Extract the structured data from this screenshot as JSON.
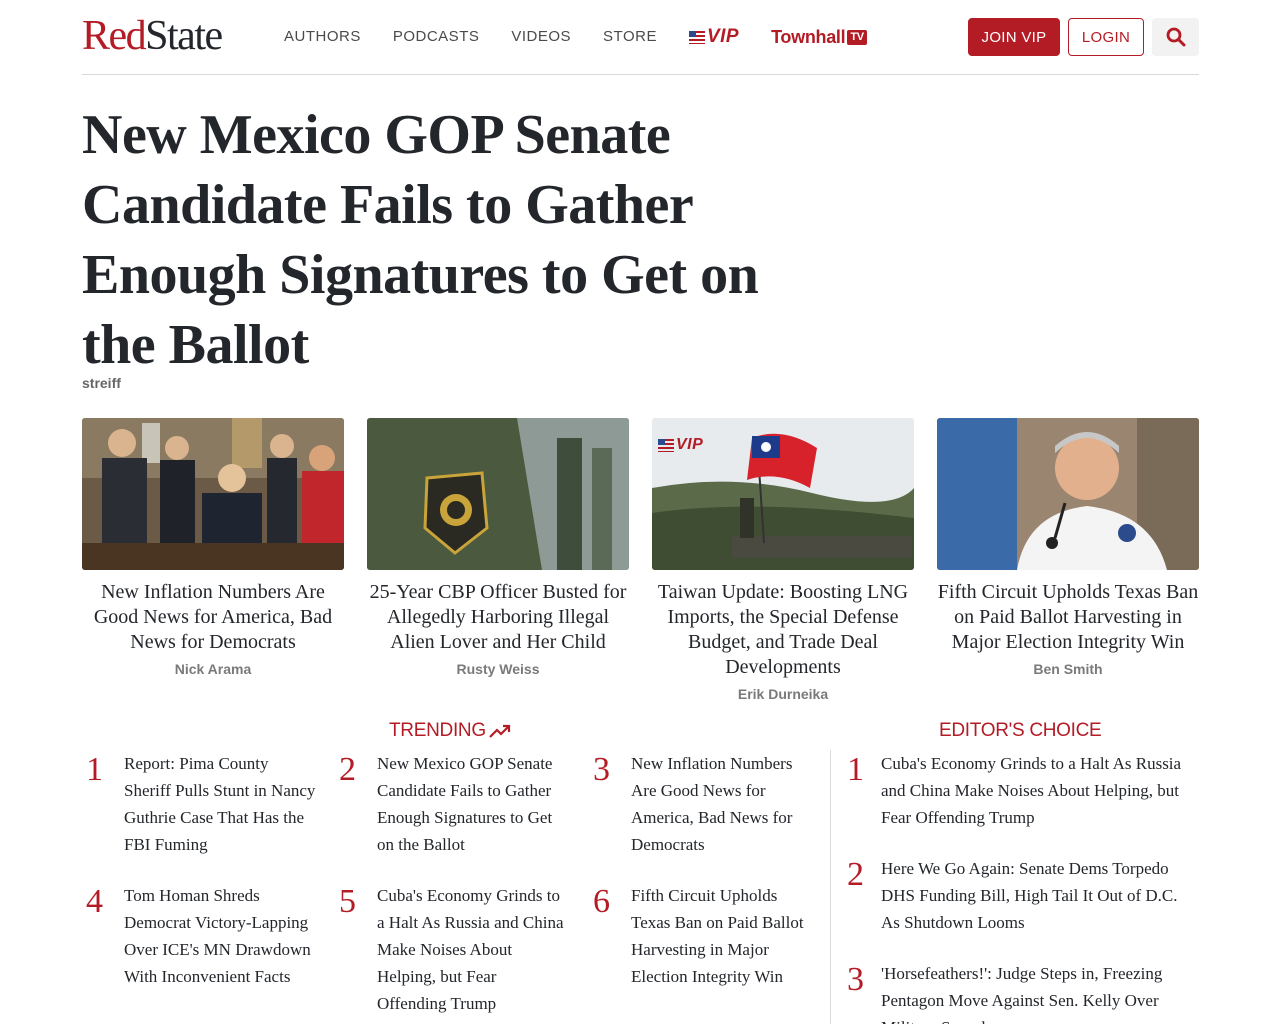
{
  "brand": {
    "logo_part1": "Red",
    "logo_part2": "State",
    "red": "#b41c25",
    "dark": "#23262b"
  },
  "nav": {
    "authors": "AUTHORS",
    "podcasts": "PODCASTS",
    "videos": "VIDEOS",
    "store": "STORE",
    "vip": "VIP",
    "townhall": "Townhall",
    "townhall_tv": "TV"
  },
  "header_buttons": {
    "join_vip": "JOIN VIP",
    "login": "LOGIN",
    "search_icon": "search-icon"
  },
  "article": {
    "headline": "New Mexico GOP Senate Candidate Fails to Gather Enough Signatures to Get on the Ballot",
    "byline": "streiff"
  },
  "cards": [
    {
      "title": "New Inflation Numbers Are Good News for America, Bad News for Democrats",
      "author": "Nick Arama"
    },
    {
      "title": "25-Year CBP Officer Busted for Allegedly Harboring Illegal Alien Lover and Her Child",
      "author": "Rusty Weiss"
    },
    {
      "title": "Taiwan Update: Boosting LNG Imports, the Special Defense Budget, and Trade Deal Developments",
      "author": "Erik Durneika",
      "badge": "VIP"
    },
    {
      "title": "Fifth Circuit Upholds Texas Ban on Paid Ballot Harvesting in Major Election Integrity Win",
      "author": "Ben Smith"
    }
  ],
  "trending": {
    "heading": "TRENDING",
    "items": [
      {
        "num": "1",
        "text": "Report: Pima County Sheriff Pulls Stunt in Nancy Guthrie Case That Has the FBI Fuming"
      },
      {
        "num": "2",
        "text": "New Mexico GOP Senate Candidate Fails to Gather Enough Signatures to Get on the Ballot"
      },
      {
        "num": "3",
        "text": "New Inflation Numbers Are Good News for America, Bad News for Democrats"
      },
      {
        "num": "4",
        "text": "Tom Homan Shreds Democrat Victory-Lapping Over ICE's MN Drawdown With Inconvenient Facts"
      },
      {
        "num": "5",
        "text": "Cuba's Economy Grinds to a Halt As Russia and China Make Noises About Helping, but Fear Offending Trump"
      },
      {
        "num": "6",
        "text": "Fifth Circuit Upholds Texas Ban on Paid Ballot Harvesting in Major Election Integrity Win"
      }
    ]
  },
  "editors_choice": {
    "heading": "EDITOR'S CHOICE",
    "items": [
      {
        "num": "1",
        "text": "Cuba's Economy Grinds to a Halt As Russia and China Make Noises About Helping, but Fear Offending Trump"
      },
      {
        "num": "2",
        "text": "Here We Go Again: Senate Dems Torpedo DHS Funding Bill, High Tail It Out of D.C. As Shutdown Looms"
      },
      {
        "num": "3",
        "text": "'Horsefeathers!': Judge Steps in, Freezing Pentagon Move Against Sen. Kelly Over Military Speech"
      }
    ]
  }
}
